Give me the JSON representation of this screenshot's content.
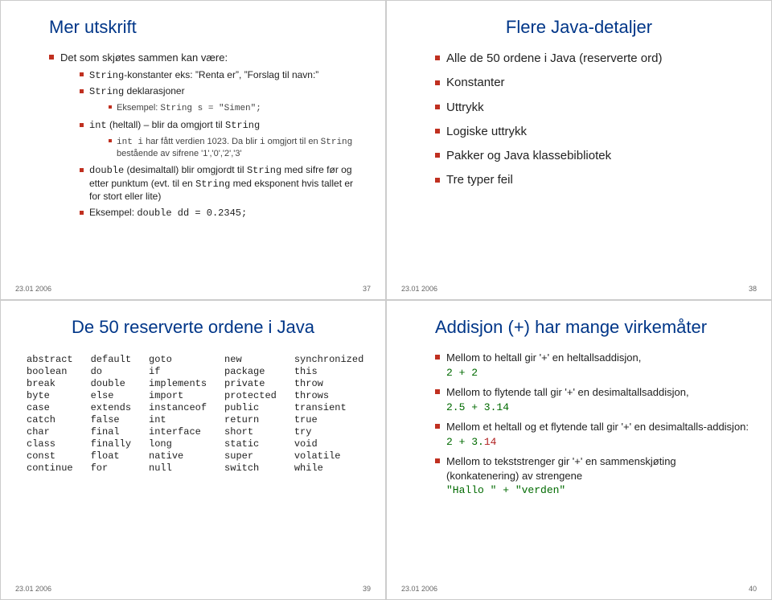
{
  "slide1": {
    "title": "Mer utskrift",
    "b1": "Det som skjøtes sammen kan være:",
    "b1a": "String",
    "b1a_pre": "",
    "sub1_pre": "",
    "sub1": "-konstanter eks: ”Renta er”, ”Forslag til navn:”",
    "sub2_pre": "String",
    "sub2": " deklarasjoner",
    "sub2ex_pre": "Eksempel: ",
    "sub2ex_code": "String s = \"Simen\";",
    "sub3_pre": "int",
    "sub3": " (heltall) – blir da omgjort til ",
    "sub3_post": "String",
    "sub3ex_pre": "int i",
    "sub3ex_mid": " har fått verdien 1023. Da blir ",
    "sub3ex_code": "i",
    "sub3ex_post": " omgjort til en ",
    "sub3ex_str": "String",
    "sub3ex_after": " bestående av sifrene '1','0','2','3'",
    "sub4_pre": "double",
    "sub4": " (desimaltall) blir omgjordt til ",
    "sub4_mid": "String",
    "sub4_post": " med sifre før og etter punktum (evt. til en ",
    "sub4_str2": "String",
    "sub4_after": " med eksponent hvis tallet er for stort eller lite)",
    "sub4ex_pre": "Eksempel: ",
    "sub4ex_code": "double dd = 0.2345;",
    "date": "23.01 2006",
    "page": "37"
  },
  "slide2": {
    "title": "Flere Java-detaljer",
    "items": [
      "Alle de 50 ordene i Java (reserverte ord)",
      "Konstanter",
      "Uttrykk",
      "Logiske uttrykk",
      "Pakker og Java klassebibliotek",
      "Tre typer feil"
    ],
    "date": "23.01 2006",
    "page": "38"
  },
  "slide3": {
    "title": "De 50 reserverte ordene i Java",
    "keywords": [
      [
        "abstract",
        "default",
        "goto",
        "new",
        "synchronized"
      ],
      [
        "boolean",
        "do",
        "if",
        "package",
        "this"
      ],
      [
        "break",
        "double",
        "implements",
        "private",
        "throw"
      ],
      [
        "byte",
        "else",
        "import",
        "protected",
        "throws"
      ],
      [
        "case",
        "extends",
        "instanceof",
        "public",
        "transient"
      ],
      [
        "catch",
        "false",
        "int",
        "return",
        "true"
      ],
      [
        "char",
        "final",
        "interface",
        "short",
        "try"
      ],
      [
        "class",
        "finally",
        "long",
        "static",
        "void"
      ],
      [
        "const",
        "float",
        "native",
        "super",
        "volatile"
      ],
      [
        "continue",
        "for",
        "null",
        "switch",
        "while"
      ]
    ],
    "date": "23.01 2006",
    "page": "39"
  },
  "slide4": {
    "title": "Addisjon (+) har mange virkemåter",
    "i1": "Mellom to heltall gir '+' en heltallsaddisjon,",
    "i1c": " 2 + 2",
    "i2": "Mellom to flytende tall gir '+' en desimaltallsaddisjon,",
    "i2c": " 2.5 + 3.14",
    "i3a": "Mellom et heltall og et flytende tall gir '+' en desimaltalls-addisjon: ",
    "i3b_code_pre": "2 + 3.",
    "i3b_red": "14",
    "i4a": "Mellom to tekststrenger gir '+' en sammenskjøting (konkatenering) av strengene",
    "i4c": " \"Hallo \" + \"verden\"",
    "date": "23.01 2006",
    "page": "40"
  }
}
